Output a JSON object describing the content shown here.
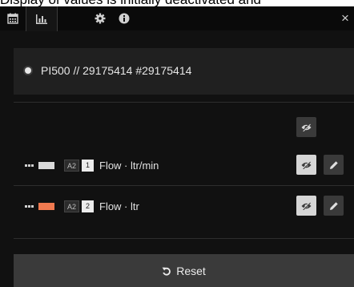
{
  "caption": {
    "text": "Display of values is initially deactivated and"
  },
  "toolbar": {
    "tabs": [
      {
        "icon": "calendar-icon"
      },
      {
        "icon": "bar-chart-icon",
        "active": true
      },
      {
        "icon": "gear-icon"
      },
      {
        "icon": "info-icon"
      }
    ],
    "close_label": "×"
  },
  "source": {
    "label": "PI500 // 29175414 #29175414",
    "selected": true
  },
  "series": [
    {
      "color": "#d9d9d9",
      "axis": "A2",
      "index": "1",
      "label": "Flow · ltr/min"
    },
    {
      "color": "#f07a50",
      "axis": "A2",
      "index": "2",
      "label": "Flow · ltr"
    }
  ],
  "reset": {
    "icon": "undo-icon",
    "label": "Reset"
  }
}
